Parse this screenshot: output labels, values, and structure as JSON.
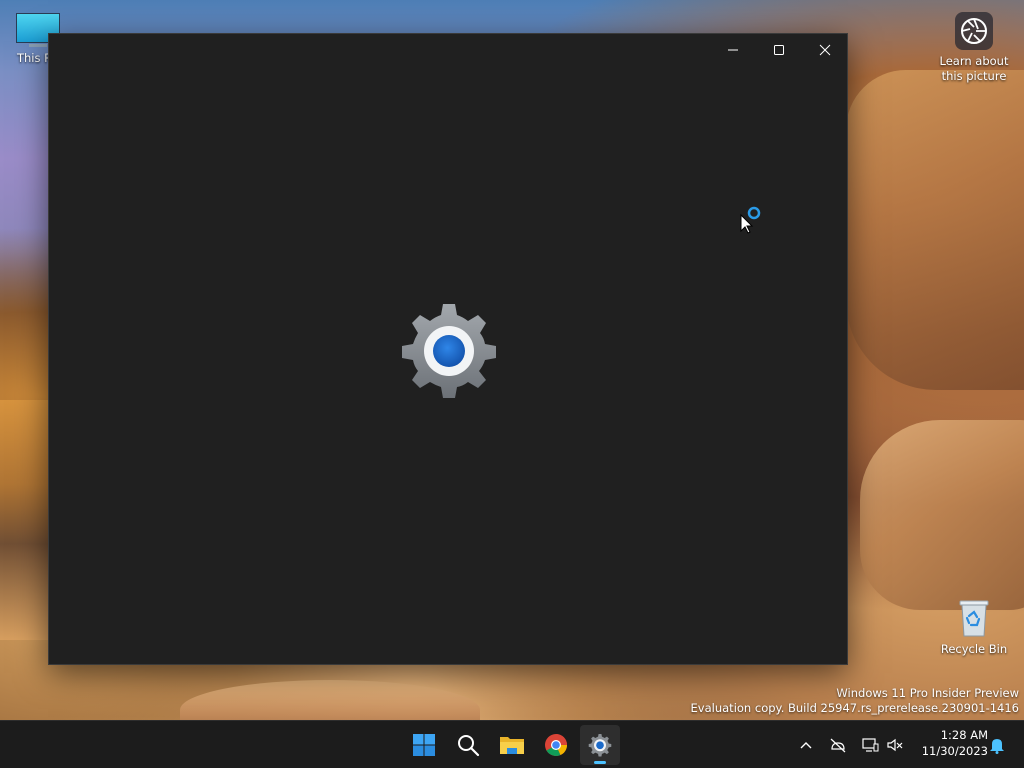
{
  "desktop": {
    "icons": [
      {
        "id": "this-pc",
        "label": "This PC",
        "icon": "monitor-icon"
      },
      {
        "id": "learn",
        "label": "Learn about this picture",
        "icon": "camera-aperture-icon"
      },
      {
        "id": "recycle",
        "label": "Recycle Bin",
        "icon": "recycle-bin-icon"
      }
    ],
    "watermark": {
      "line1": "Windows 11 Pro Insider Preview",
      "line2": "Evaluation copy. Build 25947.rs_prerelease.230901-1416"
    }
  },
  "window": {
    "title": "",
    "state": "loading",
    "splash_icon": "settings-gear-icon",
    "controls": {
      "minimize": "minimize-icon",
      "maximize": "maximize-icon",
      "close": "close-icon"
    }
  },
  "taskbar": {
    "apps": [
      {
        "id": "start",
        "icon": "windows-logo-icon"
      },
      {
        "id": "search",
        "icon": "search-icon"
      },
      {
        "id": "explorer",
        "icon": "folder-icon"
      },
      {
        "id": "chrome",
        "icon": "chrome-icon"
      },
      {
        "id": "settings",
        "icon": "settings-gear-icon",
        "active": true
      }
    ],
    "tray": {
      "time": "1:28 AM",
      "date": "11/30/2023",
      "icons": [
        "chevron-up-icon",
        "network-offline-icon",
        "display-icon",
        "volume-muted-icon",
        "notification-bell-icon"
      ]
    }
  },
  "colors": {
    "window_bg": "#202020",
    "taskbar_bg": "#1c1c1c",
    "accent": "#4cc2ff",
    "gear_blue": "#1b6ac9",
    "gear_gray": "#8b9095"
  }
}
